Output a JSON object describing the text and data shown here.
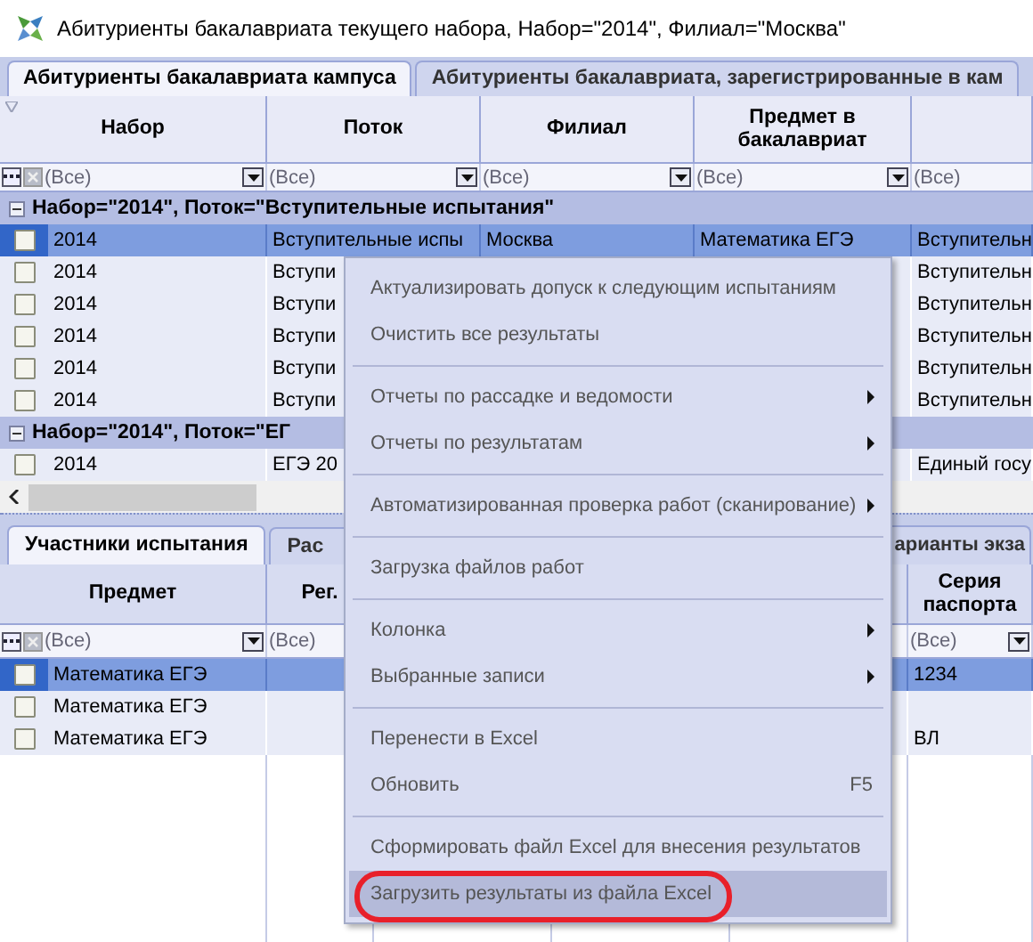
{
  "window": {
    "title": "Абитуриенты бакалавриата текущего набора, Набор=\"2014\", Филиал=\"Москва\""
  },
  "tabs": [
    {
      "label": "Абитуриенты бакалавриата кампуса",
      "selected": true
    },
    {
      "label": "Абитуриенты бакалавриата, зарегистрированные в кам",
      "selected": false
    }
  ],
  "top_grid": {
    "columns": [
      {
        "label": "Набор",
        "filter": "(Все)"
      },
      {
        "label": "Поток",
        "filter": "(Все)"
      },
      {
        "label": "Филиал",
        "filter": "(Все)"
      },
      {
        "label": "Предмет в бакалавриат",
        "filter": "(Все)"
      },
      {
        "filter": "(Все)"
      }
    ],
    "groups": [
      {
        "label": "Набор=\"2014\", Поток=\"Вступительные испытания\"",
        "expanded": true,
        "rows": [
          {
            "selected": true,
            "checked": false,
            "cells": [
              "2014",
              "Вступительные испы",
              "Москва",
              "Математика ЕГЭ",
              "Вступительн"
            ]
          },
          {
            "selected": false,
            "checked": false,
            "cells": [
              "2014",
              "Вступи",
              null,
              null,
              "Вступительн"
            ]
          },
          {
            "selected": false,
            "checked": false,
            "cells": [
              "2014",
              "Вступи",
              null,
              null,
              "Вступительн"
            ]
          },
          {
            "selected": false,
            "checked": false,
            "cells": [
              "2014",
              "Вступи",
              null,
              null,
              "Вступительн"
            ]
          },
          {
            "selected": false,
            "checked": false,
            "cells": [
              "2014",
              "Вступи",
              null,
              null,
              "Вступительн"
            ]
          },
          {
            "selected": false,
            "checked": false,
            "cells": [
              "2014",
              "Вступи",
              null,
              null,
              "Вступительн"
            ]
          }
        ]
      },
      {
        "label": "Набор=\"2014\", Поток=\"ЕГ",
        "expanded": true,
        "rows": [
          {
            "selected": false,
            "checked": false,
            "cells": [
              "2014",
              "ЕГЭ 20",
              null,
              null,
              "Единый госу"
            ]
          }
        ]
      }
    ]
  },
  "bottom_tabs": [
    {
      "label": "Участники испытания",
      "selected": true
    },
    {
      "label": "Рас",
      "selected": false
    },
    {
      "label": "арианты экза",
      "selected": false
    }
  ],
  "bottom_grid": {
    "columns": [
      {
        "label": "Предмет",
        "filter": "(Все)"
      },
      {
        "label": "Рег.",
        "filter": "(Все)"
      },
      {},
      {},
      {},
      {
        "label": "Серия паспорта",
        "filter": "(Все)"
      }
    ],
    "rows": [
      {
        "selected": true,
        "checked": false,
        "cells": [
          "Математика ЕГЭ",
          null,
          null,
          null,
          null,
          "1234"
        ]
      },
      {
        "selected": false,
        "checked": false,
        "cells": [
          "Математика ЕГЭ",
          null,
          null,
          null,
          null,
          null
        ]
      },
      {
        "selected": false,
        "checked": false,
        "cells": [
          "Математика ЕГЭ",
          null,
          null,
          null,
          null,
          "ВЛ"
        ]
      }
    ]
  },
  "context_menu": [
    {
      "kind": "item",
      "label": "Актуализировать допуск к следующим испытаниям",
      "submenu": false,
      "highlighted": false,
      "circled": false
    },
    {
      "kind": "item",
      "label": "Очистить все результаты",
      "submenu": false,
      "highlighted": false,
      "circled": false
    },
    {
      "kind": "separator"
    },
    {
      "kind": "item",
      "label": "Отчеты по рассадке и ведомости",
      "submenu": true,
      "highlighted": false,
      "circled": false
    },
    {
      "kind": "item",
      "label": "Отчеты по результатам",
      "submenu": true,
      "highlighted": false,
      "circled": false
    },
    {
      "kind": "separator"
    },
    {
      "kind": "item",
      "label": "Автоматизированная проверка работ (сканирование)",
      "submenu": true,
      "highlighted": false,
      "circled": false
    },
    {
      "kind": "separator"
    },
    {
      "kind": "item",
      "label": "Загрузка файлов работ",
      "submenu": false,
      "highlighted": false,
      "circled": false
    },
    {
      "kind": "separator"
    },
    {
      "kind": "item",
      "label": "Колонка",
      "submenu": true,
      "highlighted": false,
      "circled": false
    },
    {
      "kind": "item",
      "label": "Выбранные записи",
      "submenu": true,
      "highlighted": false,
      "circled": false
    },
    {
      "kind": "separator"
    },
    {
      "kind": "item",
      "label": "Перенести в Excel",
      "submenu": false,
      "highlighted": false,
      "circled": false
    },
    {
      "kind": "item",
      "label": "Обновить",
      "shortcut": "F5",
      "submenu": false,
      "highlighted": false,
      "circled": false
    },
    {
      "kind": "separator"
    },
    {
      "kind": "item",
      "label": "Сформировать файл Excel для внесения результатов",
      "submenu": false,
      "highlighted": false,
      "circled": false
    },
    {
      "kind": "item",
      "label": "Загрузить результаты из файла Excel",
      "submenu": false,
      "highlighted": true,
      "circled": true
    }
  ]
}
